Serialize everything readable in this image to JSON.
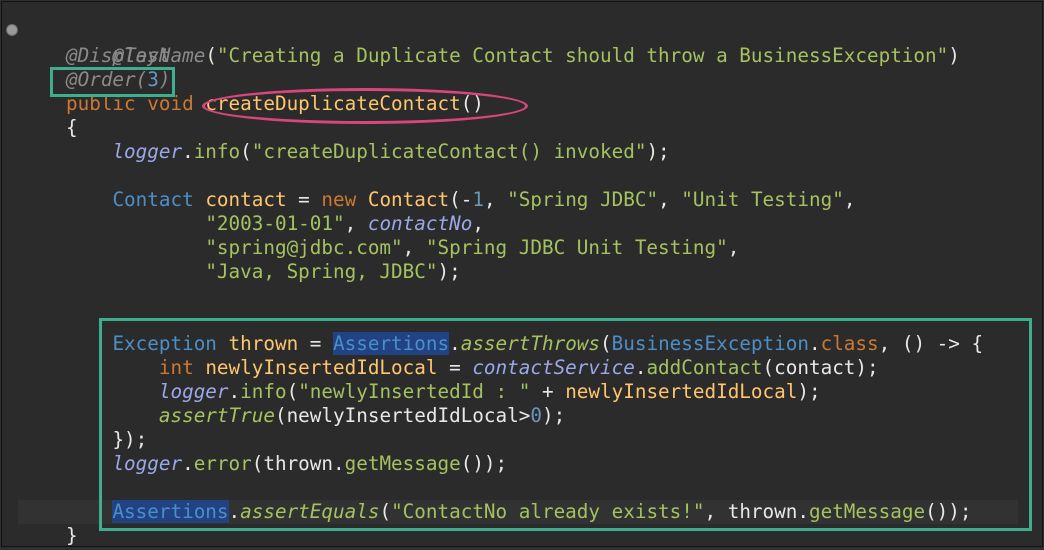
{
  "code": {
    "annotation_test": "@Test",
    "display_name_ann": "@DisplayName",
    "display_name_open": "(",
    "display_name_str": "\"Creating a Duplicate Contact should throw a BusinessException\"",
    "display_name_close": ")",
    "order_ann": "@Order",
    "order_open": "(",
    "order_num": "3",
    "order_close": ")",
    "kw_public": "public",
    "kw_void": "void",
    "method_name": "createDuplicateContact",
    "method_parens": "()",
    "brace_open": "{",
    "logger": "logger",
    "dot": ".",
    "info": "info",
    "log1_open": "(",
    "log1_str": "\"createDuplicateContact() invoked\"",
    "log1_close": ");",
    "contact_type": "Contact",
    "contact_var": "contact",
    "eq": " = ",
    "kw_new": "new",
    "contact_ctor": "Contact",
    "ctor_args1_open": "(-",
    "ctor_num": "1",
    "comma": ", ",
    "str_spring_jdbc": "\"Spring JDBC\"",
    "str_unit_testing": "\"Unit Testing\"",
    "trailing_comma": ",",
    "str_date": "\"2003-01-01\"",
    "contact_no": "contactNo",
    "str_email": "\"spring@jdbc.com\"",
    "str_spring_unit": "\"Spring JDBC Unit Testing\"",
    "str_tags": "\"Java, Spring, JDBC\"",
    "close_semicolon": ");",
    "exception_type": "Exception",
    "thrown_var": "thrown",
    "assertions": "Assertions",
    "assert_throws": "assertThrows",
    "business_exception": "BusinessException",
    "kw_class": "class",
    "lambda": ", () -> {",
    "kw_int": "int",
    "newly_var": "newlyInsertedIdLocal",
    "contact_service": "contactService",
    "add_contact": "addContact",
    "add_contact_args": "(contact);",
    "log2_str": "\"newlyInsertedId : \"",
    "plus": " + ",
    "assert_true": "assertTrue",
    "assert_true_arg_open": "(",
    "assert_true_arg_gt": ">",
    "assert_true_num": "0",
    "lambda_close": "});",
    "error": "error",
    "get_message": "getMessage",
    "get_message_close": "());",
    "assert_equals": "assertEquals",
    "msg_str": "\"ContactNo already exists!\"",
    "brace_close": "}"
  }
}
